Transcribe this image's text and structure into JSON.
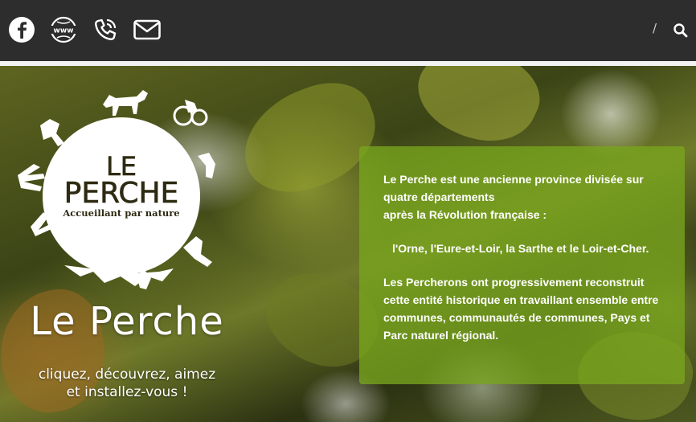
{
  "header": {
    "social": [
      {
        "name": "facebook-icon"
      },
      {
        "name": "www-icon",
        "text": "www"
      },
      {
        "name": "phone-icon"
      },
      {
        "name": "mail-icon"
      }
    ],
    "separator": "/",
    "search_icon": "search-icon",
    "colors": {
      "background": "#2d2d2d",
      "icon": "#ffffff"
    }
  },
  "hero": {
    "logo": {
      "line1": "LE",
      "line2": "PERCHE",
      "tagline": "Accueillant par nature"
    },
    "title": "Le Perche",
    "subtitle_line1": "cliquez, découvrez, aimez",
    "subtitle_line2": "et installez-vous !",
    "info": {
      "p1_line1": "Le Perche est une ancienne province divisée sur quatre départements",
      "p1_line2": "après la Révolution française :",
      "p2": "l'Orne, l'Eure-et-Loir, la Sarthe et le Loir-et-Cher.",
      "p3": "Les Percherons ont progressivement reconstruit cette entité historique en travaillant ensemble entre communes, communautés de communes, Pays et Parc naturel régional."
    },
    "colors": {
      "infobox": "#78a51e",
      "text": "#ffffff"
    }
  }
}
